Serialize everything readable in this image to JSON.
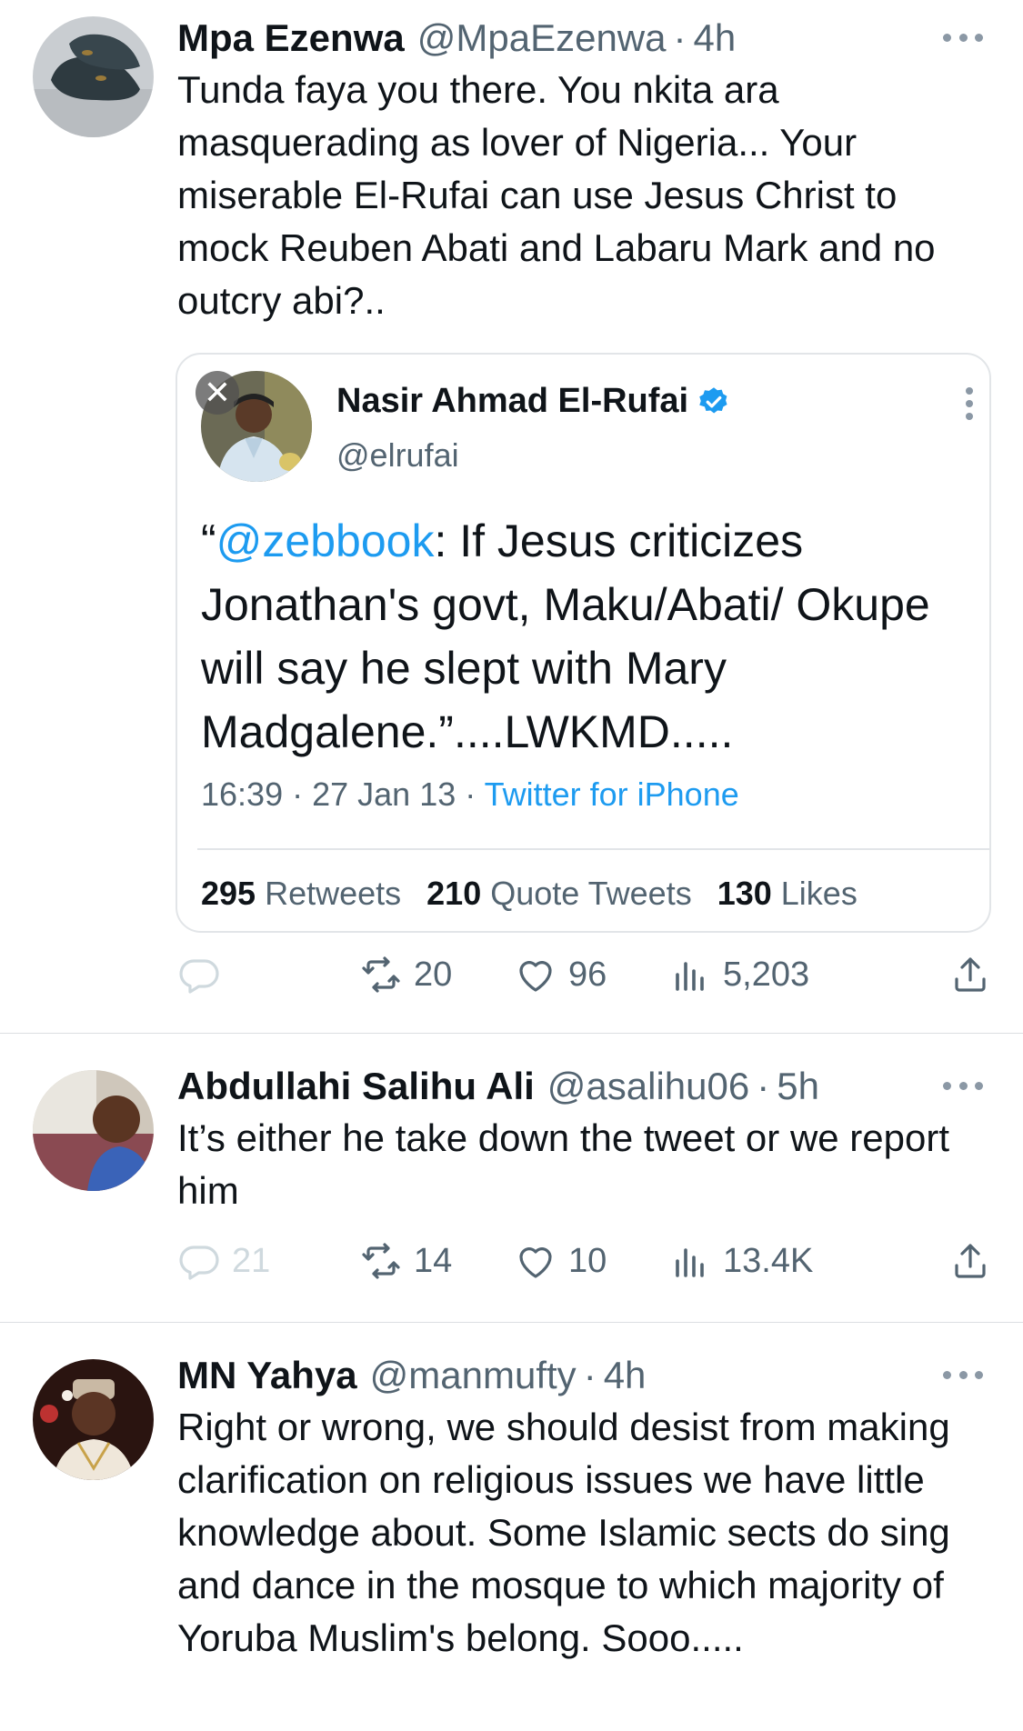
{
  "tweets": [
    {
      "name": "Mpa Ezenwa",
      "handle": "@MpaEzenwa",
      "time": "4h",
      "text": "Tunda faya you there. You nkita ara masquerading as lover of Nigeria... Your miserable El-Rufai can use Jesus Christ to mock Reuben Abati and Labaru Mark and no outcry abi?..",
      "quoted": {
        "name": "Nasir Ahmad El-Rufai",
        "handle": "@elrufai",
        "text_open_quote": "“",
        "text_mention": "@zebbook",
        "text_rest": ": If Jesus criticizes Jonathan's govt, Maku/Abati/ Okupe will say he slept with Mary Madgalene.”....LWKMD.....",
        "time": "16:39",
        "date": "27 Jan 13",
        "source": "Twitter for iPhone",
        "retweets_count": "295",
        "retweets_label": "Retweets",
        "quotes_count": "210",
        "quotes_label": "Quote Tweets",
        "likes_count": "130",
        "likes_label": "Likes"
      },
      "replies": "",
      "retweets": "20",
      "likes": "96",
      "views": "5,203"
    },
    {
      "name": "Abdullahi Salihu Ali",
      "handle": "@asalihu06",
      "time": "5h",
      "text": "It’s either he take down the tweet or we report him",
      "replies": "21",
      "retweets": "14",
      "likes": "10",
      "views": "13.4K"
    },
    {
      "name": "MN Yahya",
      "handle": "@manmufty",
      "time": "4h",
      "text": "Right or wrong, we should desist from making clarification on religious issues we have little knowledge about. Some Islamic sects do sing and dance in the mosque to which majority of Yoruba Muslim's belong. Sooo....."
    }
  ],
  "colors": {
    "link": "#1d9bf0",
    "secondary_text": "#536471",
    "primary_text": "#0f1419",
    "divider": "#dcdfe2"
  },
  "icons": [
    "reply-icon",
    "retweet-icon",
    "like-icon",
    "views-icon",
    "share-icon",
    "more-icon",
    "verified-badge-icon",
    "close-icon"
  ]
}
